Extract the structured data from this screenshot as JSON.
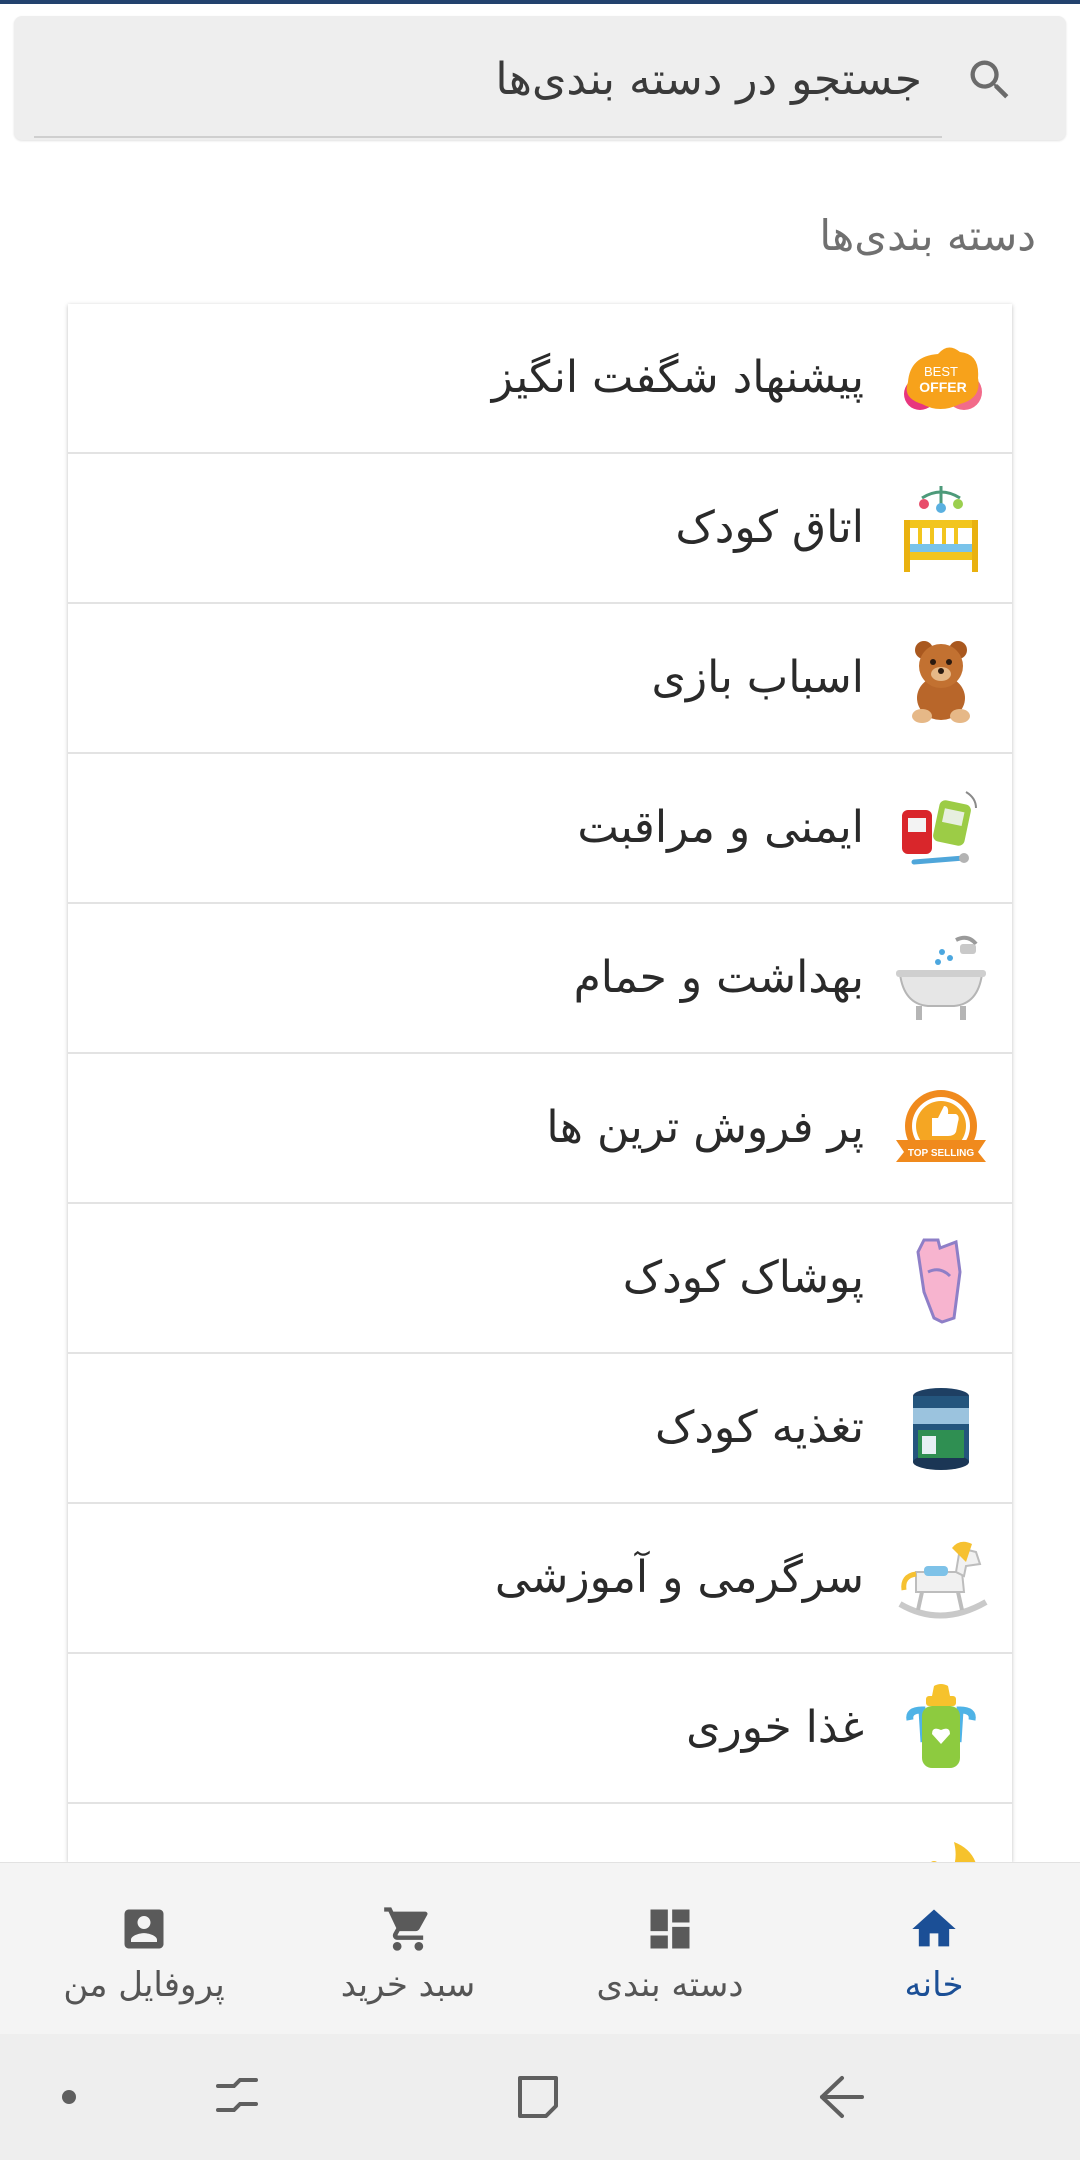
{
  "search": {
    "placeholder": "جستجو در دسته بندی‌ها",
    "icon": "search-icon"
  },
  "section_title": "دسته بندی‌ها",
  "categories": [
    {
      "label": "پیشنهاد شگفت انگیز",
      "icon": "best-offer-icon",
      "badge_top": "BEST",
      "badge_bottom": "OFFER"
    },
    {
      "label": "اتاق کودک",
      "icon": "crib-icon"
    },
    {
      "label": "اسباب بازی",
      "icon": "teddy-bear-icon"
    },
    {
      "label": "ایمنی و مراقبت",
      "icon": "baby-monitor-icon"
    },
    {
      "label": "بهداشت و حمام",
      "icon": "bathtub-icon"
    },
    {
      "label": "پر فروش ترین ها",
      "icon": "top-selling-icon",
      "badge": "TOP SELLING"
    },
    {
      "label": "پوشاک کودک",
      "icon": "baby-bodysuit-icon"
    },
    {
      "label": "تغذیه کودک",
      "icon": "formula-can-icon"
    },
    {
      "label": "سرگرمی و آموزشی",
      "icon": "rocking-horse-icon"
    },
    {
      "label": "غذا خوری",
      "icon": "baby-bottle-icon"
    },
    {
      "label": "",
      "icon": "moon-icon"
    }
  ],
  "bottom_nav": [
    {
      "label": "خانه",
      "icon": "home-icon",
      "active": true
    },
    {
      "label": "دسته بندی",
      "icon": "dashboard-icon",
      "active": false
    },
    {
      "label": "سبد خرید",
      "icon": "cart-icon",
      "active": false
    },
    {
      "label": "پروفایل من",
      "icon": "profile-icon",
      "active": false
    }
  ],
  "colors": {
    "accent": "#1b4f96",
    "nav_inactive": "#555555",
    "top_line": "#23426e"
  }
}
